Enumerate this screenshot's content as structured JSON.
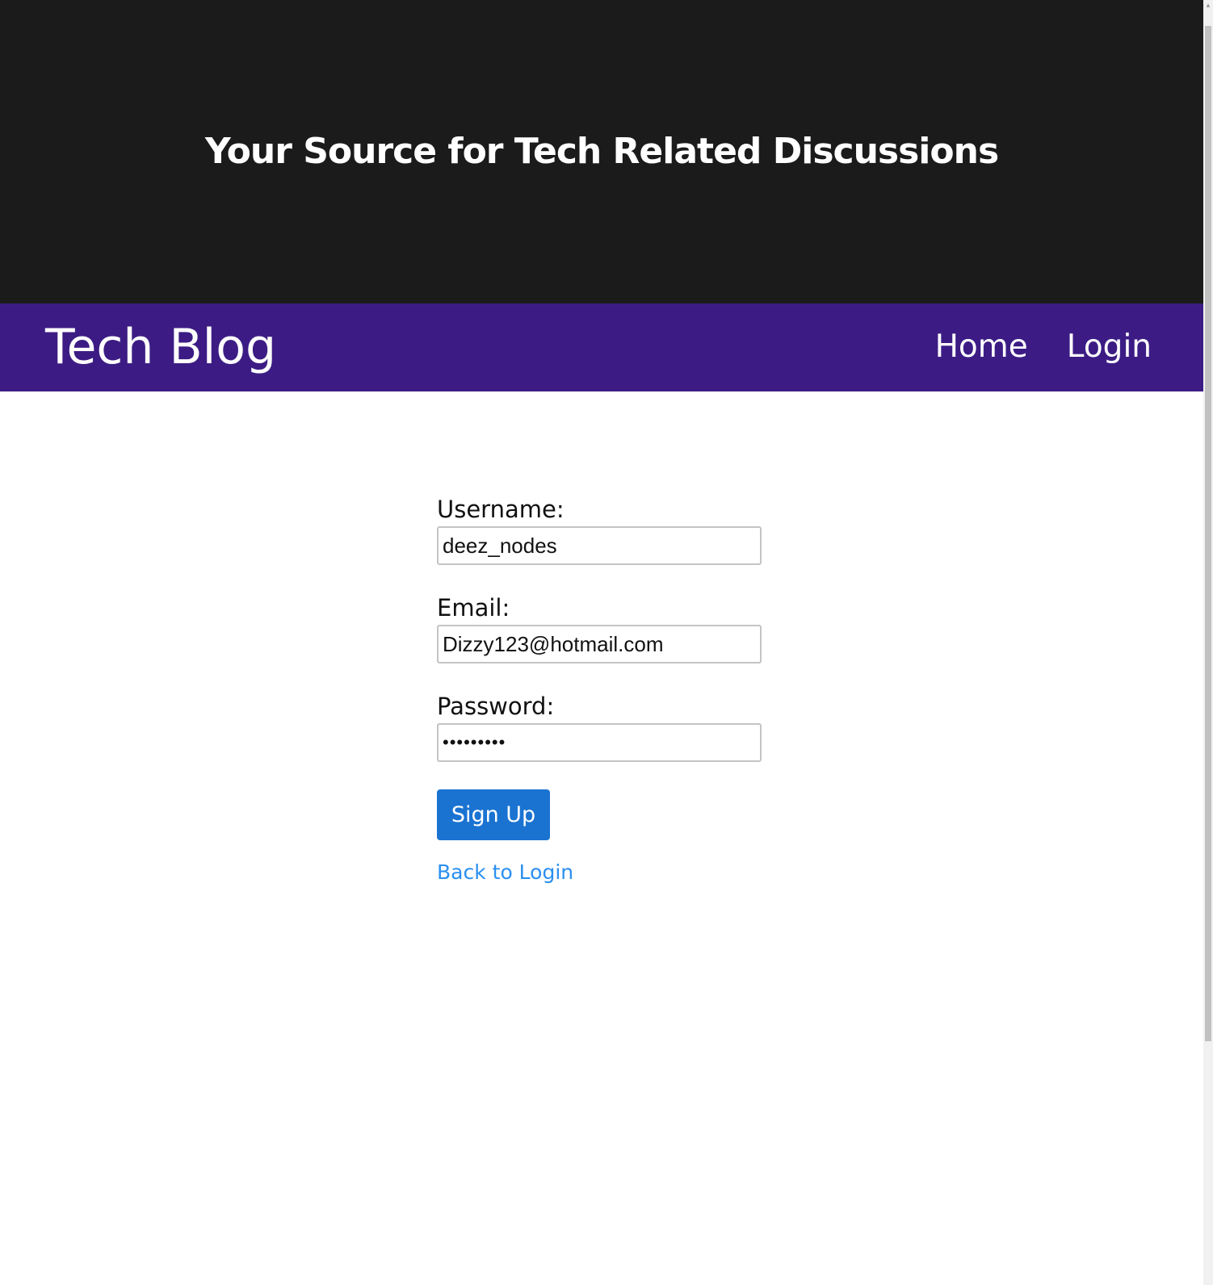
{
  "hero": {
    "title": "Your Source for Tech Related Discussions"
  },
  "navbar": {
    "brand": "Tech Blog",
    "links": [
      {
        "label": "Home"
      },
      {
        "label": "Login"
      }
    ]
  },
  "form": {
    "username": {
      "label": "Username:",
      "value": "deez_nodes"
    },
    "email": {
      "label": "Email:",
      "value": "Dizzy123@hotmail.com"
    },
    "password": {
      "label": "Password:",
      "value": "•••••••••"
    },
    "submit_label": "Sign Up",
    "back_link": "Back to Login"
  },
  "colors": {
    "hero_bg": "#1b1b1b",
    "navbar_bg": "#3c1c84",
    "button_bg": "#1a73d1",
    "link": "#2a8ff0"
  }
}
